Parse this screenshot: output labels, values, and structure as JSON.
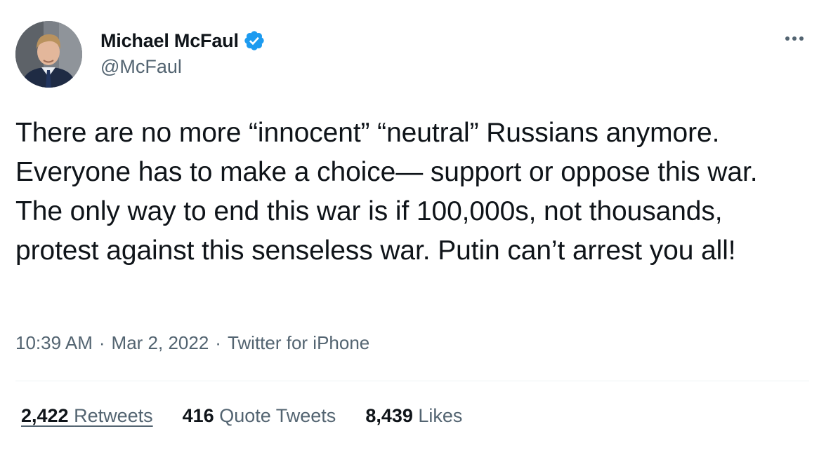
{
  "author": {
    "display_name": "Michael McFaul",
    "handle": "@McFaul",
    "verified": true
  },
  "menu": {
    "icon": "more-horizontal-icon"
  },
  "tweet": {
    "text": "There are no more “innocent” “neutral” Russians anymore. Everyone has to make a choice— support or oppose this war. The only way to end this war is if 100,000s, not thousands, protest against this senseless war. Putin can’t arrest you all!"
  },
  "meta": {
    "time": "10:39 AM",
    "separator": "·",
    "date": "Mar 2, 2022",
    "source": "Twitter for iPhone"
  },
  "stats": {
    "retweets": {
      "count": "2,422",
      "label": "Retweets"
    },
    "quote_tweets": {
      "count": "416",
      "label": "Quote Tweets"
    },
    "likes": {
      "count": "8,439",
      "label": "Likes"
    }
  },
  "colors": {
    "text_primary": "#0f1419",
    "text_secondary": "#536471",
    "verified_blue": "#1d9bf0",
    "divider": "#eff3f4"
  }
}
